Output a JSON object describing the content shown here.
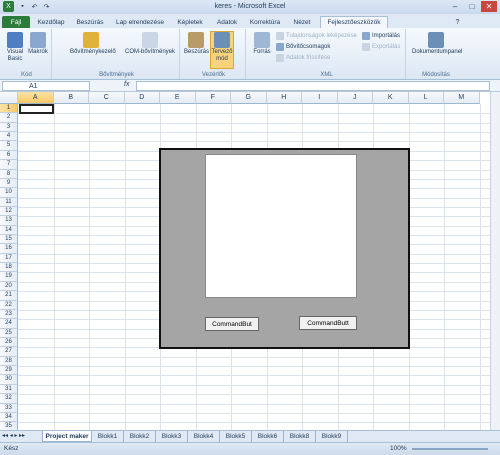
{
  "window": {
    "title": "keres  -  Microsoft Excel"
  },
  "tabs": [
    {
      "label": "Fájl"
    },
    {
      "label": "Kezdőlap"
    },
    {
      "label": "Beszúrás"
    },
    {
      "label": "Lap elrendezése"
    },
    {
      "label": "Képletek"
    },
    {
      "label": "Adatok"
    },
    {
      "label": "Korrektúra"
    },
    {
      "label": "Nézet"
    },
    {
      "label": "Fejlesztőeszközök"
    }
  ],
  "ribbon": {
    "kod": {
      "label": "Kód",
      "visual_basic": "Visual Basic",
      "makrok": "Makrók"
    },
    "bov": {
      "label": "Bővítmények",
      "bovitmenykezelo": "Bővítménykezelő",
      "com": "COM-bővítmények"
    },
    "vez": {
      "label": "Vezérlők",
      "beszuras": "Beszúrás",
      "tervezo": "Tervező mód"
    },
    "xml": {
      "label": "XML",
      "forras": "Forrás",
      "tulajdonsagok": "Tulajdonságok leképezése",
      "bovitocsomagok": "Bővítőcsomagok",
      "frissites": "Adatok frissítése",
      "importalas": "Importálás",
      "exportalas": "Exportálás"
    },
    "mod": {
      "label": "Módosítás",
      "dokumentumpanel": "Dokumentumpanel"
    }
  },
  "formula_bar": {
    "name_box": "A1",
    "fx": "fx",
    "value": ""
  },
  "columns": [
    "A",
    "B",
    "C",
    "D",
    "E",
    "F",
    "G",
    "H",
    "I",
    "J",
    "K",
    "L",
    "M"
  ],
  "rows": [
    "1",
    "2",
    "3",
    "4",
    "5",
    "6",
    "7",
    "8",
    "9",
    "10",
    "11",
    "12",
    "13",
    "14",
    "15",
    "16",
    "17",
    "18",
    "19",
    "20",
    "21",
    "22",
    "23",
    "24",
    "25",
    "26",
    "27",
    "28",
    "29",
    "30",
    "31",
    "32",
    "33",
    "34",
    "35"
  ],
  "form": {
    "button1": "CommandBut",
    "button2": "CommandButt"
  },
  "sheets": [
    "Project maker",
    "Blokk1",
    "Blokk2",
    "Blokk3",
    "Blokk4",
    "Blokk5",
    "Blokk6",
    "Blokk8",
    "Blokk9"
  ],
  "status": {
    "ready": "Kész",
    "zoom": "100%"
  }
}
